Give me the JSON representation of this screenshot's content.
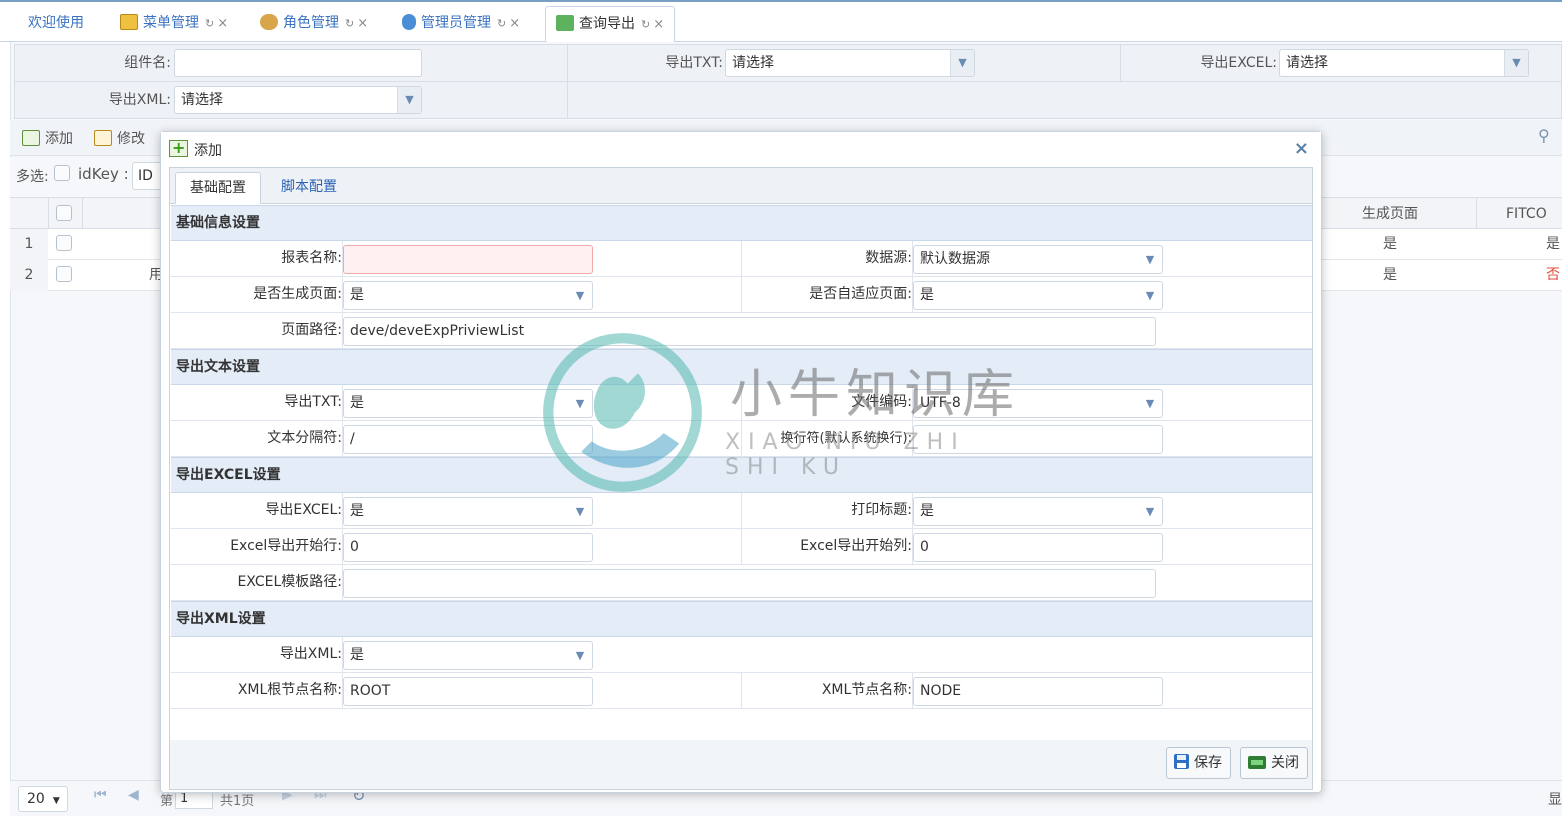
{
  "tabs": [
    {
      "label": "欢迎使用",
      "close": ""
    },
    {
      "label": "菜单管理",
      "close": "×"
    },
    {
      "label": "角色管理",
      "close": "×"
    },
    {
      "label": "管理员管理",
      "close": "×"
    },
    {
      "label": "查询导出",
      "close": "×"
    }
  ],
  "search": {
    "component_label": "组件名:",
    "component_value": "",
    "txt_label": "导出TXT:",
    "txt_value": "请选择",
    "excel_label": "导出EXCEL:",
    "excel_value": "请选择",
    "xml_label": "导出XML:",
    "xml_value": "请选择"
  },
  "toolbar": {
    "add": "添加",
    "edit": "修改"
  },
  "filter": {
    "multi": "多选:",
    "idkey": "idKey :",
    "idkey_value": "ID"
  },
  "grid": {
    "headers": {
      "gen_page": "生成页面",
      "fitco": "FITCO"
    },
    "rows": [
      {
        "num": "1",
        "c2": "",
        "gen_page": "是",
        "fit": "是"
      },
      {
        "num": "2",
        "c2": "用",
        "gen_page": "是",
        "fit": "否"
      }
    ]
  },
  "pager": {
    "size": "20",
    "page_prefix": "第",
    "page": "1",
    "of": "共1页",
    "right": "显"
  },
  "dialog": {
    "title": "添加",
    "tab_basic": "基础配置",
    "tab_script": "脚本配置",
    "sections": {
      "basic": "基础信息设置",
      "text": "导出文本设置",
      "excel": "导出EXCEL设置",
      "xml": "导出XML设置"
    },
    "fields": {
      "report_name_label": "报表名称:",
      "report_name_value": "",
      "datasource_label": "数据源:",
      "datasource_value": "默认数据源",
      "gen_page_label": "是否生成页面:",
      "gen_page_value": "是",
      "adaptive_label": "是否自适应页面:",
      "adaptive_value": "是",
      "page_path_label": "页面路径:",
      "page_path_value": "deve/deveExpPriviewList",
      "export_txt_label": "导出TXT:",
      "export_txt_value": "是",
      "encoding_label": "文件编码:",
      "encoding_value": "UTF-8",
      "separator_label": "文本分隔符:",
      "separator_value": "/",
      "newline_label": "换行符(默认系统换行):",
      "newline_value": "",
      "export_excel_label": "导出EXCEL:",
      "export_excel_value": "是",
      "print_title_label": "打印标题:",
      "print_title_value": "是",
      "excel_start_row_label": "Excel导出开始行:",
      "excel_start_row_value": "0",
      "excel_start_col_label": "Excel导出开始列:",
      "excel_start_col_value": "0",
      "excel_template_label": "EXCEL模板路径:",
      "excel_template_value": "",
      "export_xml_label": "导出XML:",
      "export_xml_value": "是",
      "xml_root_label": "XML根节点名称:",
      "xml_root_value": "ROOT",
      "xml_node_label": "XML节点名称:",
      "xml_node_value": "NODE"
    },
    "save": "保存",
    "close": "关闭"
  },
  "watermark": {
    "text": "小牛知识库",
    "sub": "XIAO NIU ZHI SHI KU"
  },
  "icons": {
    "dropdown": "▼",
    "close": "×",
    "dialog_close": "×",
    "first": "⏮",
    "prev": "◀",
    "next": "▶",
    "last": "⏭",
    "refresh": "↻",
    "search": "🔍"
  },
  "colors": {
    "accent": "#3b73c1",
    "section_bg": "#e3ecf7",
    "error_bg": "#fff1f1"
  }
}
